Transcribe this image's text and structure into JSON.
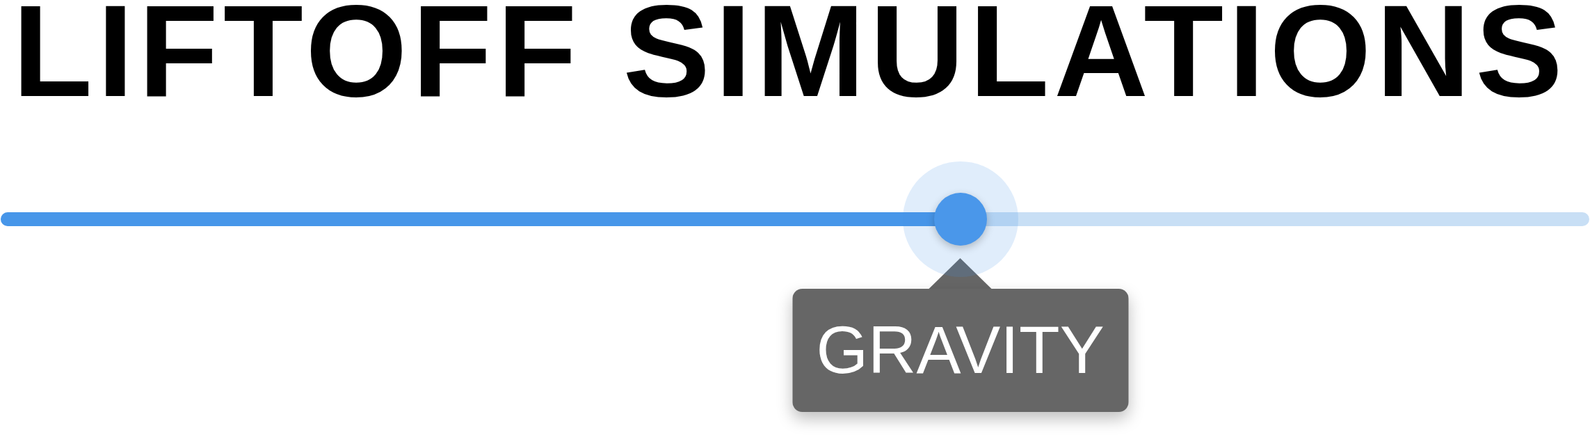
{
  "title": "LIFTOFF SIMULATIONS",
  "slider": {
    "level": 0.604,
    "focused": true,
    "tooltip": "GRAVITY"
  }
}
